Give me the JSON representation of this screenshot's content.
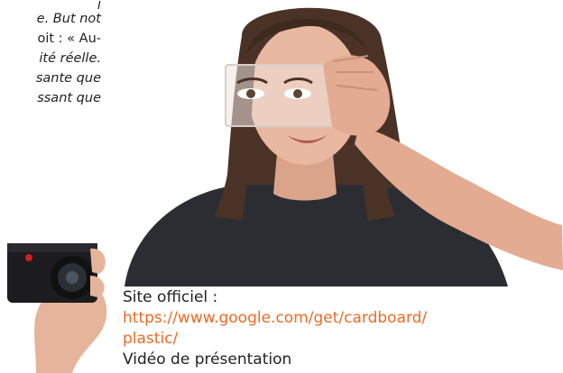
{
  "article": {
    "lines": [
      "j",
      "e. But not",
      "oit : « Au-",
      "ité réelle.",
      "sante que",
      "ssant que"
    ]
  },
  "caption": {
    "label": "Site officiel :",
    "link_line1": "https://www.google.com/get/cardboard/",
    "link_line2": "plastic/",
    "next_line": "Vidéo de présentation"
  },
  "colors": {
    "link": "#ee6a23",
    "text": "#222222",
    "shirt": "#2b2d33",
    "hair": "#4a3326",
    "skin": "#e8b9a0"
  }
}
